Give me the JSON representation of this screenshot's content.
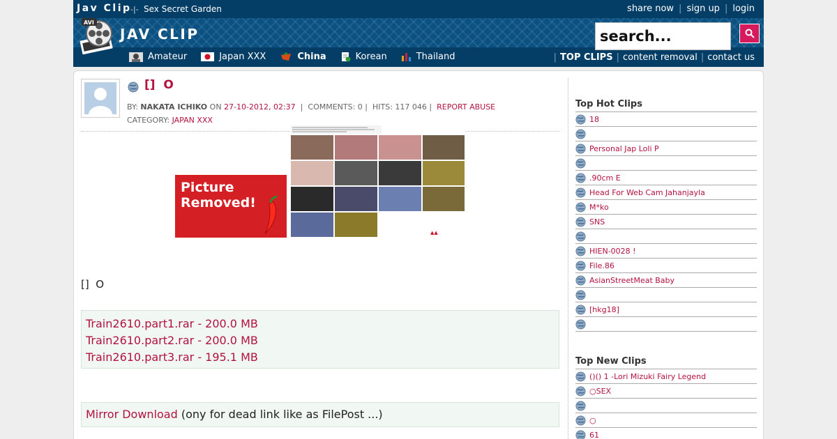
{
  "header": {
    "site_name": "Jav Clip",
    "separator": "-|-",
    "tagline": "Sex Secret Garden",
    "logo_text": "JAV CLIP",
    "logo_badge": "AVI",
    "top_links": [
      "share now",
      "sign up",
      "login"
    ]
  },
  "search": {
    "placeholder": "search..."
  },
  "categories": [
    {
      "label": "Amateur",
      "icon": "amateur-icon"
    },
    {
      "label": "Japan XXX",
      "icon": "japan-flag-icon"
    },
    {
      "label": "China",
      "icon": "china-icon"
    },
    {
      "label": "Korean",
      "icon": "korean-doc-icon"
    },
    {
      "label": "Thailand",
      "icon": "thailand-chart-icon"
    }
  ],
  "right_nav": [
    "TOP CLIPS",
    "content removal",
    "contact us"
  ],
  "post": {
    "title": "[]   O",
    "by_label": "BY:",
    "author": "NAKATA ICHIKO",
    "on_label": "ON",
    "date": "27-10-2012, 02:37",
    "comments": "COMMENTS: 0",
    "hits": "HITS: 117 046",
    "report": "REPORT ABUSE",
    "category_label": "CATEGORY:",
    "category": "JAPAN XXX",
    "picture_removed_line1": "Picture",
    "picture_removed_line2": "Removed!",
    "body_text": "[]   O",
    "downloads": [
      "Train2610.part1.rar - 200.0 MB",
      "Train2610.part2.rar - 200.0 MB",
      "Train2610.part3.rar - 195.1 MB"
    ],
    "mirror_link": "Mirror Download",
    "mirror_note": " (ony for dead link like as FilePost ...)"
  },
  "sidebar": {
    "hot_title": "Top Hot Clips",
    "hot_items": [
      "18",
      "",
      "Personal Jap Loli P",
      "",
      ".90cm E",
      "Head For Web Cam Jahanjayla",
      "M*ko",
      "SNS",
      "",
      "HIEN-0028 !",
      " File.86",
      "AsianStreetMeat Baby",
      "",
      "[hkg18]",
      ""
    ],
    "new_title": "Top New Clips",
    "new_items": [
      "()() 1 -Lori Mizuki Fairy Legend",
      "○SEX",
      "",
      "○",
      "  61"
    ]
  },
  "colors": {
    "header_bg": "#043e66",
    "link": "#b3123f",
    "search_button": "#d51b5d"
  }
}
